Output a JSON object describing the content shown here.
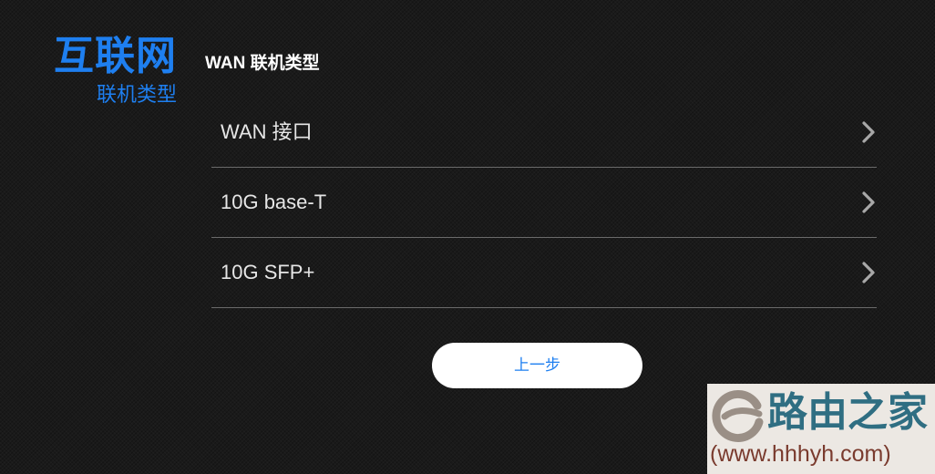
{
  "brand": {
    "title": "互联网",
    "subtitle": "联机类型"
  },
  "page": {
    "section_title": "WAN 联机类型"
  },
  "options": [
    {
      "label": "WAN 接口",
      "icon": "chevron-right-icon"
    },
    {
      "label": "10G base-T",
      "icon": "chevron-right-icon"
    },
    {
      "label": "10G SFP+",
      "icon": "chevron-right-icon"
    }
  ],
  "buttons": {
    "back_label": "上一步"
  },
  "watermark": {
    "title": "路由之家",
    "url": "(www.hhhyh.com)",
    "logo_icon": "e-swoosh-logo-icon"
  },
  "colors": {
    "accent": "#1e7ff0",
    "background": "#1a1a1a",
    "divider": "#6a6a6a",
    "watermark_bg": "#ece8e3",
    "watermark_title": "#2f6e82",
    "watermark_url": "#7a3b2e"
  }
}
